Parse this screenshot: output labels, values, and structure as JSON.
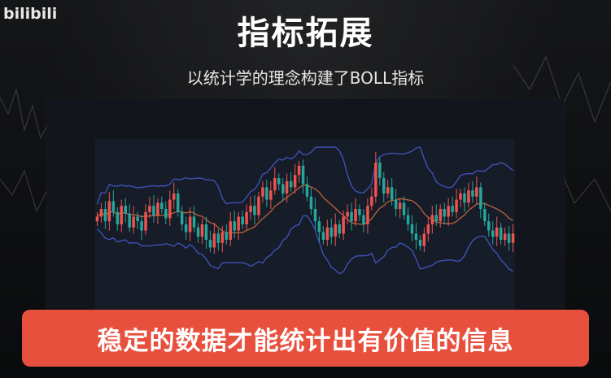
{
  "logo": {
    "text": "bilibili"
  },
  "header": {
    "title": "指标拓展",
    "subtitle": "以统计学的理念构建了BOLL指标"
  },
  "caption": {
    "text": "稳定的数据才能统计出有价值的信息"
  },
  "colors": {
    "up": "#ef5350",
    "down": "#26a69a",
    "band": "#3f51b5",
    "mid": "#b0603a",
    "caption_bg": "#e8503e",
    "panel_bg": "#12151c"
  },
  "chart_data": {
    "type": "candlestick",
    "title": "",
    "xlabel": "",
    "ylabel": "",
    "ylim": [
      0,
      100
    ],
    "indicator": "BOLL",
    "series": [
      {
        "values": [
          55,
          60,
          52,
          65,
          58,
          50,
          62,
          57,
          48,
          55,
          52,
          46,
          58,
          62,
          56,
          64,
          60,
          54,
          66,
          70,
          58,
          50,
          45,
          55,
          48,
          42,
          50,
          40,
          35,
          44,
          38,
          45,
          40,
          52,
          46,
          55,
          50,
          58,
          62,
          56,
          68,
          74,
          66,
          72,
          80,
          76,
          70,
          78,
          74,
          82,
          88,
          76,
          68,
          60,
          52,
          45,
          40,
          48,
          42,
          50,
          44,
          55,
          58,
          52,
          60,
          56,
          50,
          62,
          68,
          90,
          80,
          70,
          74,
          66,
          60,
          64,
          56,
          50,
          44,
          40,
          36,
          44,
          50,
          56,
          52,
          60,
          55,
          62,
          58,
          66,
          70,
          64,
          72,
          68,
          74,
          60,
          52,
          46,
          42,
          48,
          40,
          44,
          38,
          44
        ]
      }
    ]
  }
}
